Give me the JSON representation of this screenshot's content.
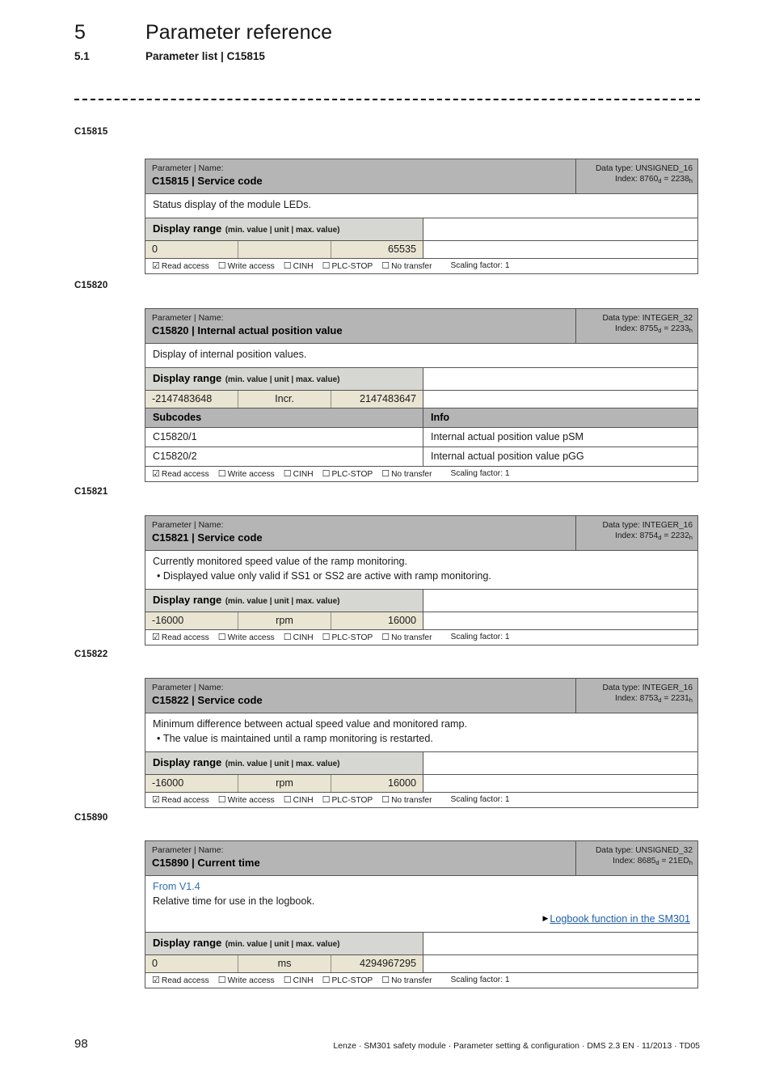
{
  "header": {
    "chapter_number": "5",
    "chapter_title": "Parameter reference",
    "section_number": "5.1",
    "section_title": "Parameter list | C15815"
  },
  "access_labels": {
    "read": "Read access",
    "write": "Write access",
    "cinh": "CINH",
    "plc_stop": "PLC-STOP",
    "no_transfer": "No transfer",
    "checked_box": "☑",
    "unchecked_box": "☐",
    "scaling": "Scaling factor: 1"
  },
  "common": {
    "param_kicker": "Parameter | Name:",
    "display_range_title": "Display range",
    "display_range_hint": "(min. value | unit | max. value)",
    "subcodes_header": "Subcodes",
    "info_header": "Info"
  },
  "colors": {
    "header_band": "#b5b5b5",
    "range_band": "#d6d6d2",
    "value_band": "#e9e5d2",
    "link": "#1f5fa9",
    "version_text": "#2e6db4",
    "border": "#555555"
  },
  "parameters": [
    {
      "margin_label": "C15815",
      "name": "C15815 | Service code",
      "data_type": "Data type: UNSIGNED_16",
      "index_prefix": "Index: 8760",
      "index_dec_sub": "d",
      "index_eq": " = 2238",
      "index_hex_sub": "h",
      "description": "Status display of the module LEDs.",
      "min": "0",
      "unit": "",
      "max": "65535"
    },
    {
      "margin_label": "C15820",
      "name": "C15820 | Internal actual position value",
      "data_type": "Data type: INTEGER_32",
      "index_prefix": "Index: 8755",
      "index_dec_sub": "d",
      "index_eq": " = 2233",
      "index_hex_sub": "h",
      "description": "Display of internal position values.",
      "min": "-2147483648",
      "unit": "Incr.",
      "max": "2147483647",
      "subcodes": [
        {
          "code": "C15820/1",
          "info": "Internal actual position value pSM"
        },
        {
          "code": "C15820/2",
          "info": "Internal actual position value pGG"
        }
      ]
    },
    {
      "margin_label": "C15821",
      "name": "C15821 | Service code",
      "data_type": "Data type: INTEGER_16",
      "index_prefix": "Index: 8754",
      "index_dec_sub": "d",
      "index_eq": " = 2232",
      "index_hex_sub": "h",
      "description": "Currently monitored speed value of the ramp monitoring.",
      "bullet": "Displayed value only valid if SS1 or SS2 are active with ramp monitoring.",
      "min": "-16000",
      "unit": "rpm",
      "max": "16000"
    },
    {
      "margin_label": "C15822",
      "name": "C15822 | Service code",
      "data_type": "Data type: INTEGER_16",
      "index_prefix": "Index: 8753",
      "index_dec_sub": "d",
      "index_eq": " = 2231",
      "index_hex_sub": "h",
      "description": "Minimum difference between actual speed value and monitored ramp.",
      "bullet": "The value is maintained until a ramp monitoring is restarted.",
      "min": "-16000",
      "unit": "rpm",
      "max": "16000"
    },
    {
      "margin_label": "C15890",
      "name": "C15890 | Current time",
      "data_type": "Data type: UNSIGNED_32",
      "index_prefix": "Index: 8685",
      "index_dec_sub": "d",
      "index_eq": " = 21ED",
      "index_hex_sub": "h",
      "version_note": "From V1.4",
      "description": "Relative time for use in the logbook.",
      "cross_reference": "Logbook function in the SM301",
      "min": "0",
      "unit": "ms",
      "max": "4294967295"
    }
  ],
  "footer": {
    "page_number": "98",
    "imprint": "Lenze · SM301 safety module · Parameter setting & configuration · DMS 2.3 EN · 11/2013 · TD05"
  }
}
